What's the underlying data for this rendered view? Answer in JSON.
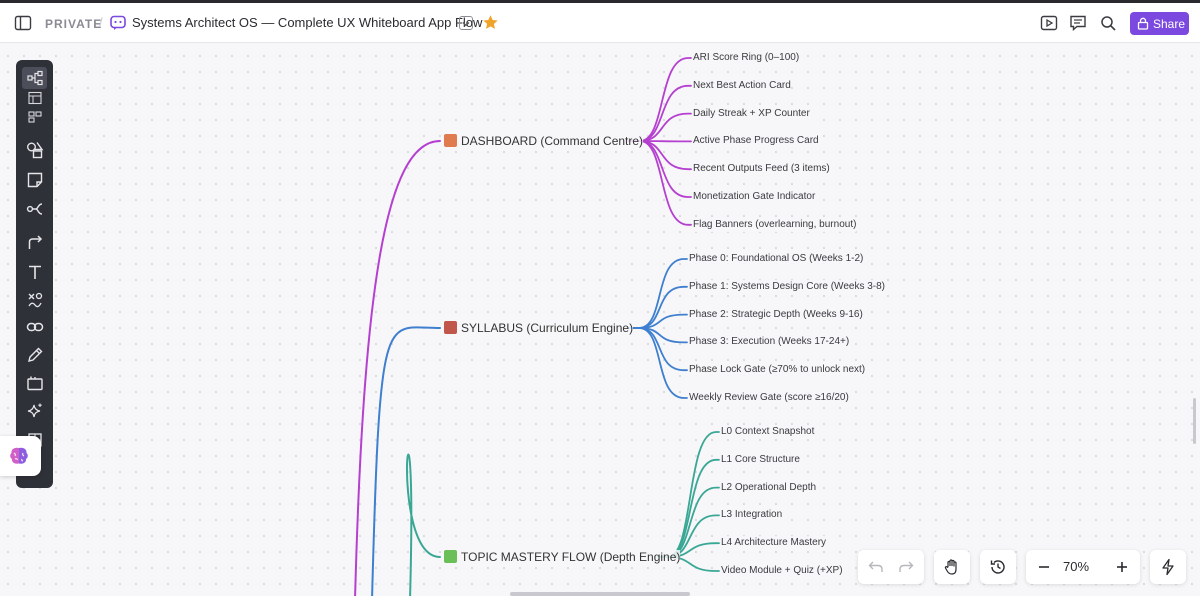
{
  "topbar": {
    "privacy_label": "PRIVATE",
    "separator": "/",
    "board_title": "Systems Architect OS — Complete UX Whiteboard App Flow",
    "share_label": "Share",
    "brand_color": "#7b48e0",
    "icons": [
      "sidebar-toggle-icon",
      "board-icon",
      "chevron-down-icon",
      "star-icon",
      "present-icon",
      "comment-icon",
      "search-icon",
      "lock-icon"
    ]
  },
  "toolbar": {
    "tools": [
      "mind-map-icon",
      "table-icon",
      "kanban-icon",
      "shapes-icon",
      "sticky-note-icon",
      "connector-icon",
      "arrow-icon",
      "text-icon",
      "draw-shapes-icon",
      "link-icon",
      "pen-icon",
      "frame-icon",
      "ai-sparkle-icon",
      "template-icon"
    ]
  },
  "mindmap": {
    "branches": [
      {
        "label": "DASHBOARD (Command Centre)",
        "icon": "house-icon",
        "color": "#b540d0",
        "children": [
          "ARI Score Ring (0–100)",
          "Next Best Action Card",
          "Daily Streak + XP Counter",
          "Active Phase Progress Card",
          "Recent Outputs Feed (3 items)",
          "Monetization Gate Indicator",
          "Flag Banners (overlearning, burnout)"
        ]
      },
      {
        "label": "SYLLABUS (Curriculum Engine)",
        "icon": "books-icon",
        "color": "#3f7fcf",
        "children": [
          "Phase 0: Foundational OS (Weeks 1-2)",
          "Phase 1: Systems Design Core (Weeks 3-8)",
          "Phase 2: Strategic Depth (Weeks 9-16)",
          "Phase 3: Execution (Weeks 17-24+)",
          "Phase Lock Gate (≥70% to unlock next)",
          "Weekly Review Gate (score ≥16/20)"
        ]
      },
      {
        "label": "TOPIC MASTERY FLOW (Depth Engine)",
        "icon": "puzzle-icon",
        "color": "#3aa795",
        "children": [
          "L0 Context Snapshot",
          "L1 Core Structure",
          "L2 Operational Depth",
          "L3 Integration",
          "L4 Architecture Mastery",
          "Video Module + Quiz (+XP)"
        ]
      }
    ]
  },
  "bottom_bar": {
    "icons": [
      "undo-icon",
      "redo-icon",
      "hand-icon",
      "history-icon",
      "zoom-out-icon",
      "zoom-in-icon",
      "lightning-icon"
    ],
    "zoom_level": "70%"
  }
}
